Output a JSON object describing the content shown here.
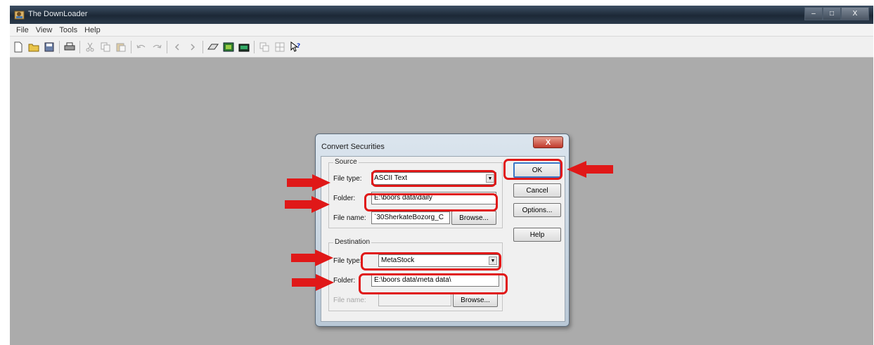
{
  "window": {
    "title": "The DownLoader",
    "controls": {
      "minimize": "–",
      "maximize": "□",
      "close": "X"
    }
  },
  "menubar": {
    "items": [
      "File",
      "View",
      "Tools",
      "Help"
    ]
  },
  "toolbar": {
    "icons": [
      "new-icon",
      "open-icon",
      "save-icon",
      "print-icon",
      "cut-icon",
      "copy-icon",
      "paste-icon",
      "undo-icon",
      "redo-icon",
      "prev-icon",
      "next-icon",
      "convert-icon",
      "download-icon",
      "folder-icon",
      "window-icon",
      "grid-icon",
      "context-help-icon"
    ]
  },
  "dialog": {
    "title": "Convert Securities",
    "close_glyph": "X",
    "source": {
      "legend": "Source",
      "file_type_label": "File type:",
      "file_type_value": "ASCII Text",
      "folder_label": "Folder:",
      "folder_value": "E:\\boors data\\daily",
      "file_name_label": "File name:",
      "file_name_value": "`30SherkateBozorg_C",
      "browse_label": "Browse..."
    },
    "destination": {
      "legend": "Destination",
      "file_type_label": "File type:",
      "file_type_value": "MetaStock",
      "folder_label": "Folder:",
      "folder_value": "E:\\boors data\\meta data\\",
      "file_name_label": "File name:",
      "file_name_value": "",
      "browse_label": "Browse..."
    },
    "buttons": {
      "ok": "OK",
      "cancel": "Cancel",
      "options": "Options...",
      "help": "Help"
    }
  },
  "colors": {
    "annotation_red": "#e01818",
    "workspace_gray": "#ababab"
  }
}
